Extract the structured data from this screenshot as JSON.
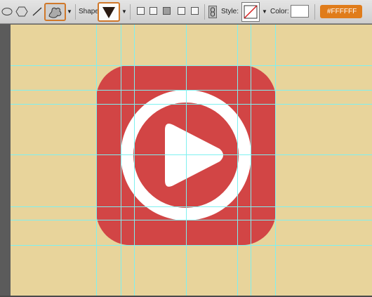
{
  "toolbar": {
    "shape_label": "Shape:",
    "style_label": "Style:",
    "color_label": "Color:",
    "color_hex": "#FFFFFF",
    "colors": {
      "accent": "#d0782a",
      "badge": "#e07c1a",
      "swatch": "#ffffff"
    }
  },
  "canvas": {
    "background": "#e8d49b",
    "icon": {
      "square_color": "#d24545",
      "ring_color": "#ffffff",
      "play_color": "#ffffff"
    },
    "guide_color": "#7ff0f0"
  }
}
